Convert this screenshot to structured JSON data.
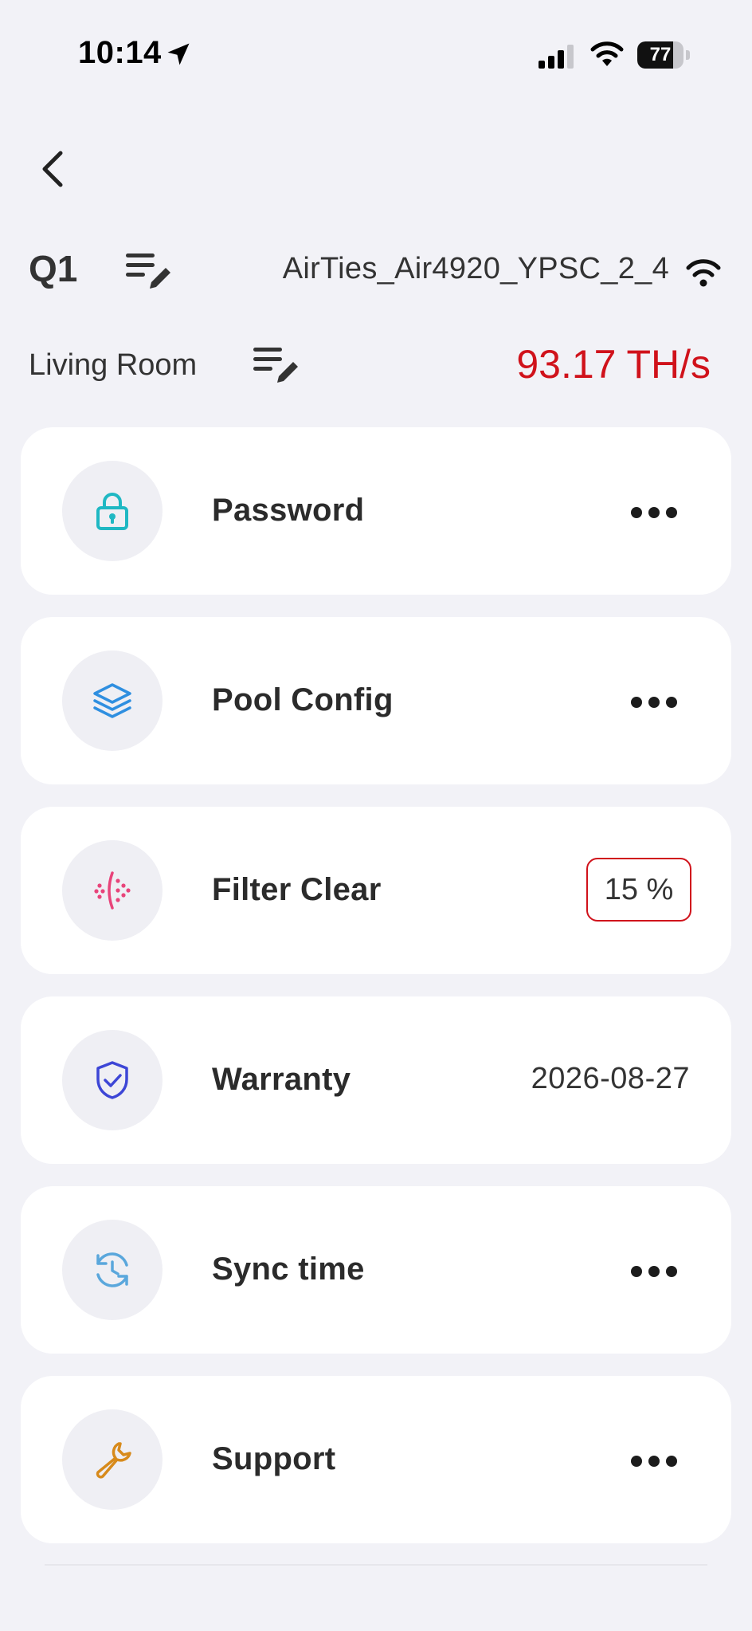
{
  "status_bar": {
    "time": "10:14",
    "battery_level": 77,
    "battery_text": "77"
  },
  "device": {
    "name": "Q1",
    "wifi_ssid": "AirTies_Air4920_YPSC_2_4",
    "room": "Living Room",
    "hashrate": "93.17 TH/s"
  },
  "colors": {
    "accent_red": "#d0121b",
    "password_icon": "#1fb8c3",
    "pool_icon": "#2f8fe0",
    "filter_icon": "#e8447a",
    "warranty_icon": "#3d46d6",
    "sync_icon": "#5aa7dc",
    "support_icon": "#d78a1b"
  },
  "menu": [
    {
      "label": "Password",
      "icon": "lock-icon",
      "trailing": "more"
    },
    {
      "label": "Pool Config",
      "icon": "layers-icon",
      "trailing": "more"
    },
    {
      "label": "Filter Clear",
      "icon": "filter-icon",
      "trailing": "badge",
      "value": "15 %"
    },
    {
      "label": "Warranty",
      "icon": "shield-check-icon",
      "trailing": "text",
      "value": "2026-08-27"
    },
    {
      "label": "Sync time",
      "icon": "clock-sync-icon",
      "trailing": "more"
    },
    {
      "label": "Support",
      "icon": "wrench-icon",
      "trailing": "more"
    }
  ]
}
